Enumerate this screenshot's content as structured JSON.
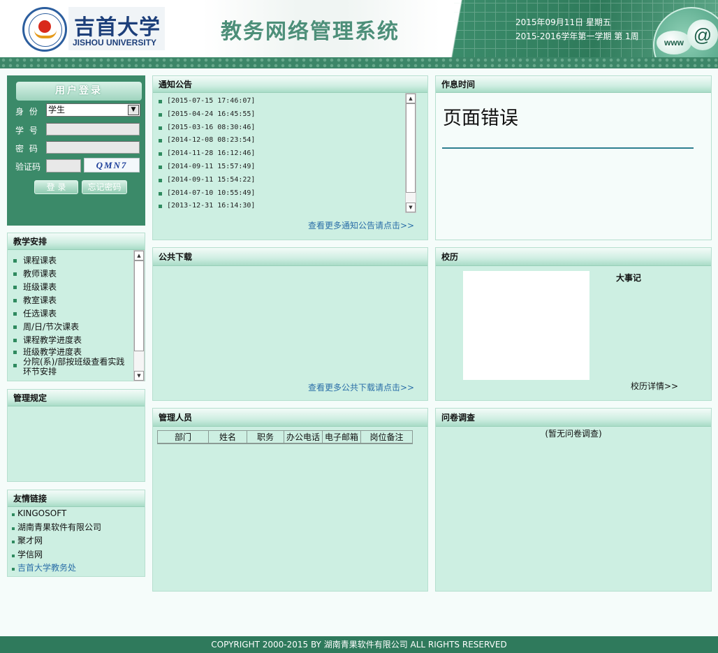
{
  "header": {
    "logo_cn": "吉首大学",
    "logo_en": "JISHOU UNIVERSITY",
    "system_title": "教务网络管理系统",
    "date": "2015年09月11日 星期五",
    "term": "2015-2016学年第一学期 第 1周",
    "www_label": "www",
    "at_label": "@"
  },
  "login": {
    "title": "用户登录",
    "identity_label": "身 份",
    "identity_value": "学生",
    "student_id_label": "学 号",
    "password_label": "密 码",
    "captcha_label": "验证码",
    "captcha_text": "QMN7",
    "login_button": "登 录",
    "forgot_button": "忘记密码"
  },
  "teaching": {
    "title": "教学安排",
    "items": [
      "课程课表",
      "教师课表",
      "班级课表",
      "教室课表",
      "任选课表",
      "周/日/节次课表",
      "课程教学进度表",
      "班级教学进度表",
      "分院(系)/部按班级查看实践环节安排"
    ]
  },
  "rules": {
    "title": "管理规定"
  },
  "friend_links": {
    "title": "友情链接",
    "items": [
      "KINGOSOFT",
      "湖南青果软件有限公司",
      "聚才网",
      "学信网",
      "吉首大学教务处"
    ]
  },
  "notices": {
    "title": "通知公告",
    "items": [
      "[2015-07-15 17:46:07]",
      "[2015-04-24 16:45:55]",
      "[2015-03-16 08:30:46]",
      "[2014-12-08 08:23:54]",
      "[2014-11-28 16:12:46]",
      "[2014-09-11 15:57:49]",
      "[2014-09-11 15:54:22]",
      "[2014-07-10 10:55:49]",
      "[2013-12-31 16:14:30]"
    ],
    "more": "查看更多通知公告请点击>>"
  },
  "downloads": {
    "title": "公共下载",
    "more": "查看更多公共下载请点击>>"
  },
  "managers": {
    "title": "管理人员",
    "columns": [
      "部门",
      "姓名",
      "职务",
      "办公电话",
      "电子邮箱",
      "岗位备注"
    ]
  },
  "schedule": {
    "title": "作息时间",
    "error_text": "页面错误"
  },
  "calendar": {
    "title": "校历",
    "events_title": "大事记",
    "details": "校历详情>>"
  },
  "survey": {
    "title": "问卷调查",
    "empty": "(暂无问卷调查)"
  },
  "footer": {
    "copyright": "COPYRIGHT 2000-2015 BY 湖南青果软件有限公司 ALL RIGHTS RESERVED"
  }
}
